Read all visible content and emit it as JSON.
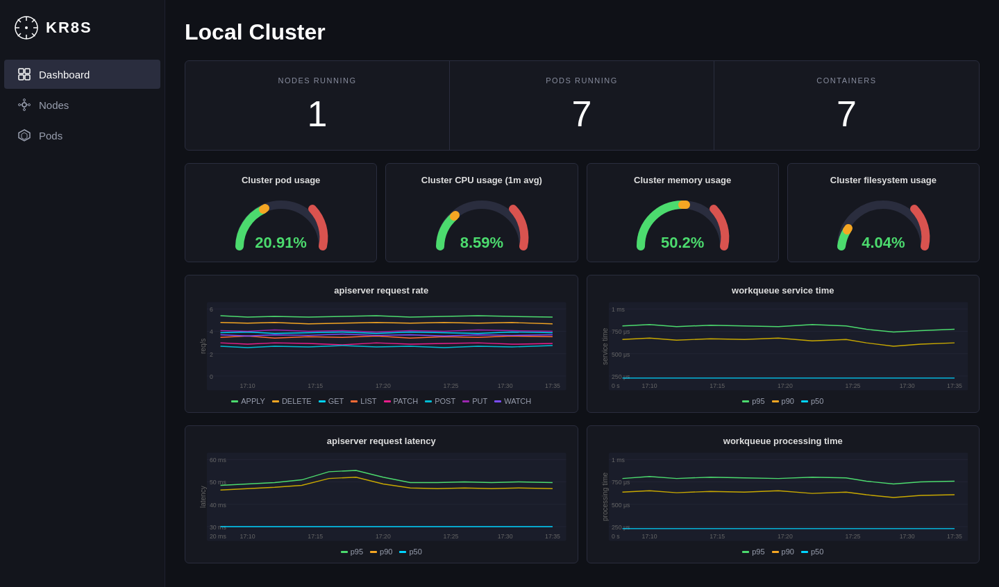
{
  "app": {
    "logo_text": "KR8S",
    "page_title": "Local Cluster"
  },
  "sidebar": {
    "nav_items": [
      {
        "label": "Dashboard",
        "icon": "dashboard",
        "active": true
      },
      {
        "label": "Nodes",
        "icon": "nodes",
        "active": false
      },
      {
        "label": "Pods",
        "icon": "pods",
        "active": false
      }
    ]
  },
  "stats": [
    {
      "label": "NODES RUNNING",
      "value": "1"
    },
    {
      "label": "PODS RUNNING",
      "value": "7"
    },
    {
      "label": "CONTAINERS",
      "value": "7"
    }
  ],
  "gauges": [
    {
      "title": "Cluster pod usage",
      "value": "20.91%",
      "percent": 20.91
    },
    {
      "title": "Cluster CPU usage (1m avg)",
      "value": "8.59%",
      "percent": 8.59
    },
    {
      "title": "Cluster memory usage",
      "value": "50.2%",
      "percent": 50.2
    },
    {
      "title": "Cluster filesystem usage",
      "value": "4.04%",
      "percent": 4.04
    }
  ],
  "charts": {
    "request_rate": {
      "title": "apiserver request rate",
      "y_label": "req/s",
      "y_ticks": [
        "6",
        "4",
        "2",
        "0"
      ],
      "x_ticks": [
        "17:10",
        "17:15",
        "17:20",
        "17:25",
        "17:30",
        "17:35"
      ],
      "legend": [
        {
          "label": "APPLY",
          "color": "#4cdb6e"
        },
        {
          "label": "DELETE",
          "color": "#f5a623"
        },
        {
          "label": "GET",
          "color": "#00d4ff"
        },
        {
          "label": "LIST",
          "color": "#ff6b35"
        },
        {
          "label": "PATCH",
          "color": "#e91e8c"
        },
        {
          "label": "POST",
          "color": "#00bcd4"
        },
        {
          "label": "PUT",
          "color": "#9c27b0"
        },
        {
          "label": "WATCH",
          "color": "#7c4dff"
        }
      ]
    },
    "workqueue_service": {
      "title": "workqueue service time",
      "y_label": "service time",
      "y_ticks": [
        "1 ms",
        "750 μs",
        "500 μs",
        "250 μs",
        "0 s"
      ],
      "x_ticks": [
        "17:10",
        "17:15",
        "17:20",
        "17:25",
        "17:30",
        "17:35"
      ],
      "legend": [
        {
          "label": "p95",
          "color": "#4cdb6e"
        },
        {
          "label": "p90",
          "color": "#f5a623"
        },
        {
          "label": "p50",
          "color": "#00d4ff"
        }
      ]
    },
    "request_latency": {
      "title": "apiserver request latency",
      "y_label": "latency",
      "y_ticks": [
        "60 ms",
        "50 ms",
        "40 ms",
        "30 ms",
        "20 ms"
      ],
      "x_ticks": [
        "17:10",
        "17:15",
        "17:20",
        "17:25",
        "17:30",
        "17:35"
      ],
      "legend": [
        {
          "label": "p95",
          "color": "#4cdb6e"
        },
        {
          "label": "p90",
          "color": "#f5a623"
        },
        {
          "label": "p50",
          "color": "#00d4ff"
        }
      ]
    },
    "workqueue_processing": {
      "title": "workqueue processing time",
      "y_label": "processing time",
      "y_ticks": [
        "1 ms",
        "750 μs",
        "500 μs",
        "250 μs",
        "0 s"
      ],
      "x_ticks": [
        "17:10",
        "17:15",
        "17:20",
        "17:25",
        "17:30",
        "17:35"
      ],
      "legend": [
        {
          "label": "p95",
          "color": "#4cdb6e"
        },
        {
          "label": "p90",
          "color": "#f5a623"
        },
        {
          "label": "p50",
          "color": "#00d4ff"
        }
      ]
    }
  }
}
